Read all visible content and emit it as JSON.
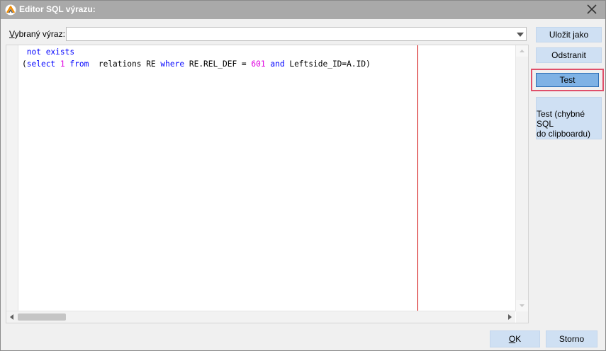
{
  "window": {
    "title": "Editor SQL výrazu:"
  },
  "expression": {
    "label_prefix": "V",
    "label_rest": "ybraný výraz:",
    "selected_value": ""
  },
  "editor": {
    "lines": [
      [
        {
          "t": " ",
          "c": "txt"
        },
        {
          "t": "not exists",
          "c": "kw"
        }
      ],
      [
        {
          "t": "(",
          "c": "txt"
        },
        {
          "t": "select",
          "c": "kw"
        },
        {
          "t": " ",
          "c": "txt"
        },
        {
          "t": "1",
          "c": "num"
        },
        {
          "t": " ",
          "c": "txt"
        },
        {
          "t": "from",
          "c": "kw"
        },
        {
          "t": "  relations RE ",
          "c": "txt"
        },
        {
          "t": "where",
          "c": "kw"
        },
        {
          "t": " RE.REL_DEF = ",
          "c": "txt"
        },
        {
          "t": "601",
          "c": "num"
        },
        {
          "t": " ",
          "c": "txt"
        },
        {
          "t": "and",
          "c": "kw"
        },
        {
          "t": " Leftside_ID=A.ID)",
          "c": "txt"
        }
      ]
    ]
  },
  "buttons": {
    "save_as": "Uložit jako",
    "delete": "Odstranit",
    "test": "Test",
    "test_clipboard_line1": "Test (chybné SQL",
    "test_clipboard_line2": "do clipboardu)",
    "ok_accel": "O",
    "ok_rest": "K",
    "cancel": "Storno"
  },
  "colors": {
    "keyword": "#0000ff",
    "number": "#e000e0",
    "margin_line": "#d00000",
    "highlight_border": "#e0506a",
    "titlebar": "#a9a9a9"
  }
}
